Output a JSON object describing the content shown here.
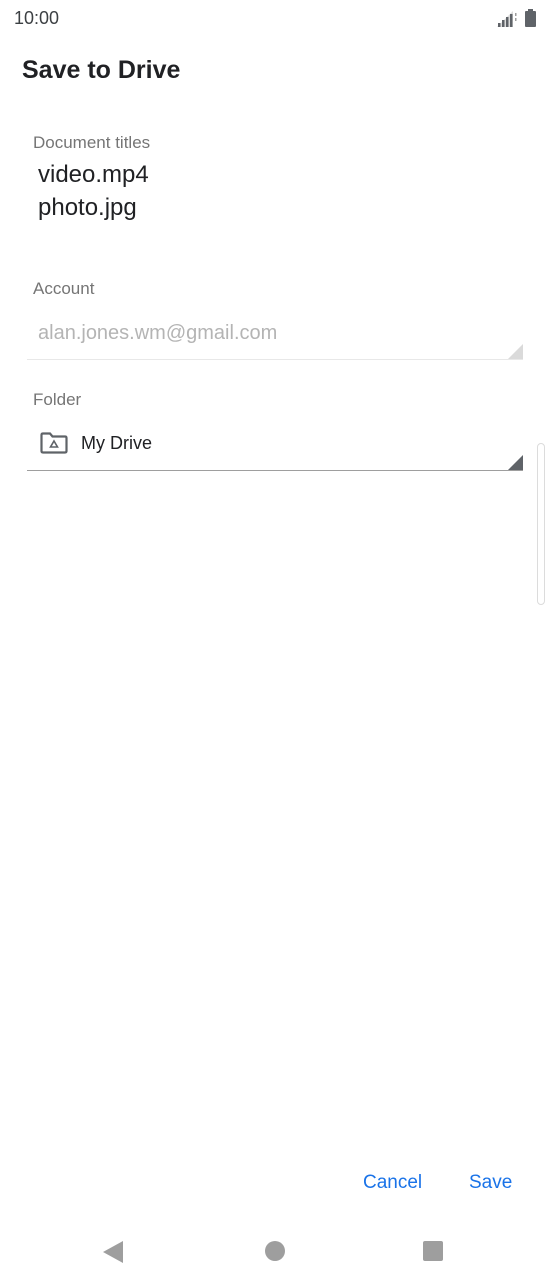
{
  "status_bar": {
    "time": "10:00",
    "signal_icon": "signal-icon",
    "battery_icon": "battery-icon"
  },
  "dialog": {
    "title": "Save to Drive",
    "document_titles": {
      "label": "Document titles",
      "items": [
        "video.mp4",
        "photo.jpg"
      ]
    },
    "account": {
      "label": "Account",
      "value": "alan.jones.wm@gmail.com"
    },
    "folder": {
      "label": "Folder",
      "value": "My Drive",
      "icon": "drive-folder-icon"
    },
    "buttons": {
      "cancel": "Cancel",
      "save": "Save"
    }
  },
  "nav_bar": {
    "back_icon": "back-icon",
    "home_icon": "home-icon",
    "recents_icon": "recents-icon"
  },
  "colors": {
    "accent": "#1a73e8",
    "label": "#757575",
    "disabled_text": "#b4b4b4"
  }
}
